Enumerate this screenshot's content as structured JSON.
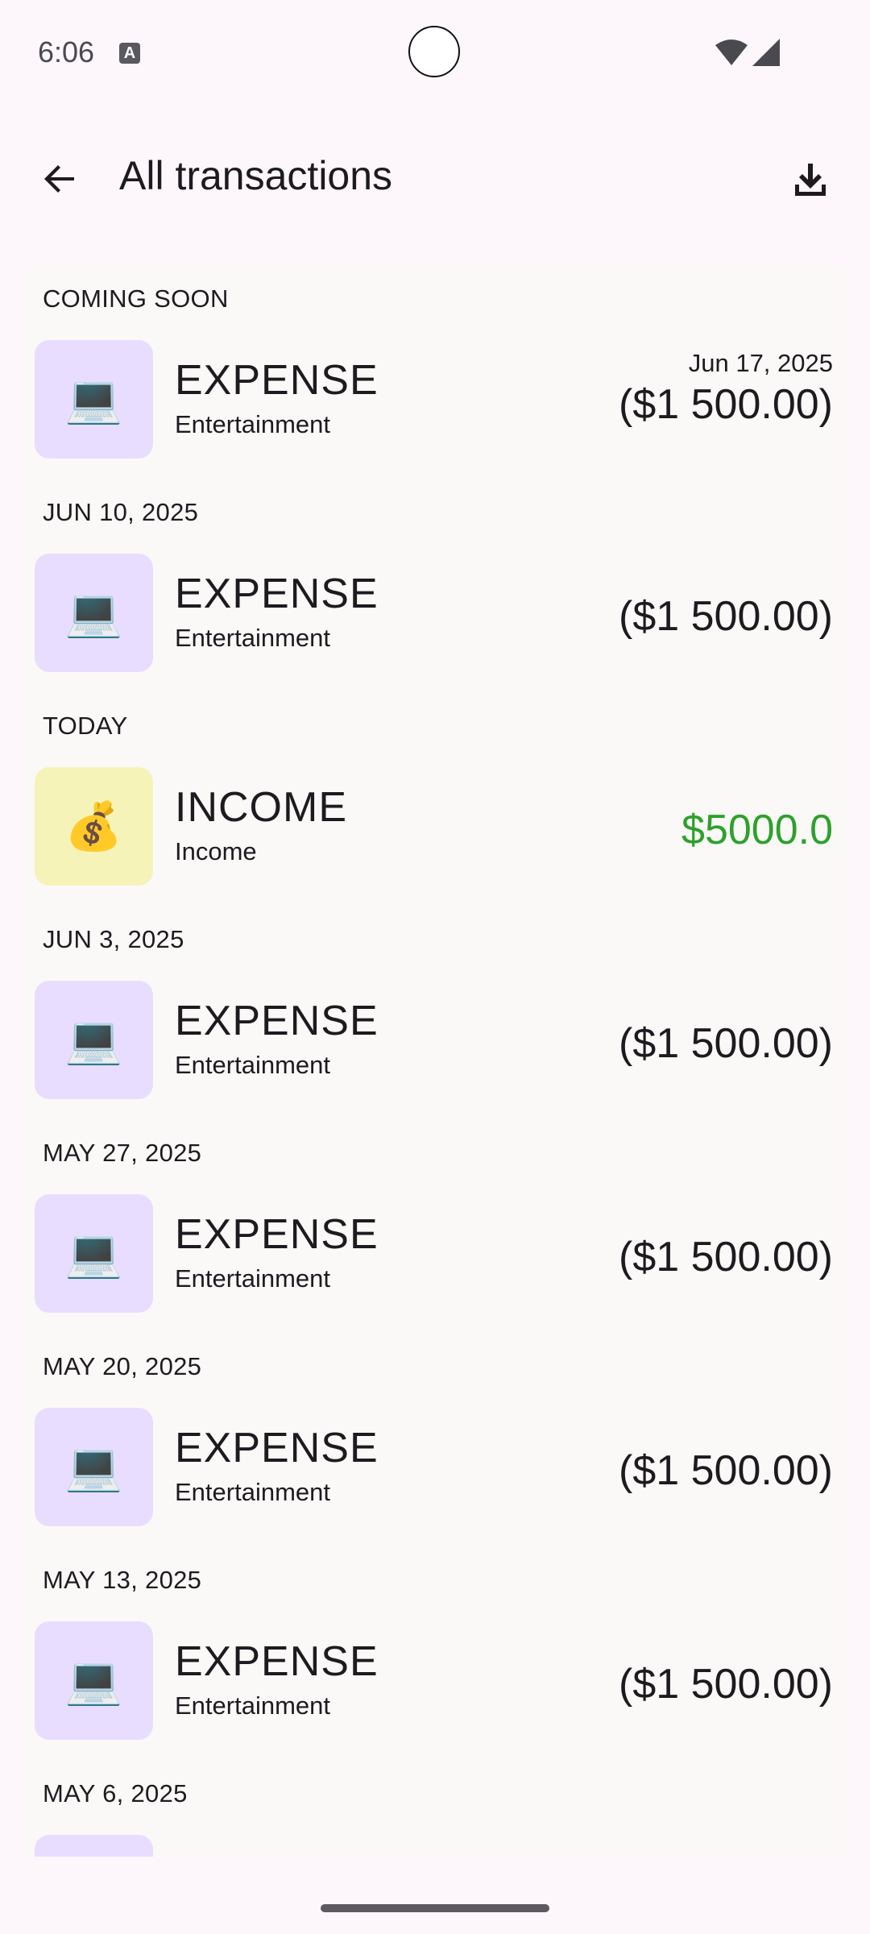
{
  "status_bar": {
    "time": "6:06",
    "a_icon_letter": "A"
  },
  "app_bar": {
    "title": "All transactions",
    "back_icon": "arrow-back-icon",
    "download_icon": "download-icon"
  },
  "sections": [
    {
      "header": "COMING SOON",
      "transaction": {
        "icon": "💻",
        "icon_name": "laptop-icon",
        "type": "EXPENSE",
        "category": "Entertainment",
        "date": "Jun 17, 2025",
        "amount": "($1 500.00)"
      }
    },
    {
      "header": "JUN 10, 2025",
      "transaction": {
        "icon": "💻",
        "icon_name": "laptop-icon",
        "type": "EXPENSE",
        "category": "Entertainment",
        "amount": "($1 500.00)"
      }
    },
    {
      "header": "TODAY",
      "transaction": {
        "icon": "💰",
        "icon_name": "money-bag-icon",
        "type": "INCOME",
        "category": "Income",
        "amount": "$5000.0"
      }
    },
    {
      "header": "JUN 3, 2025",
      "transaction": {
        "icon": "💻",
        "icon_name": "laptop-icon",
        "type": "EXPENSE",
        "category": "Entertainment",
        "amount": "($1 500.00)"
      }
    },
    {
      "header": "MAY 27, 2025",
      "transaction": {
        "icon": "💻",
        "icon_name": "laptop-icon",
        "type": "EXPENSE",
        "category": "Entertainment",
        "amount": "($1 500.00)"
      }
    },
    {
      "header": "MAY 20, 2025",
      "transaction": {
        "icon": "💻",
        "icon_name": "laptop-icon",
        "type": "EXPENSE",
        "category": "Entertainment",
        "amount": "($1 500.00)"
      }
    },
    {
      "header": "MAY 13, 2025",
      "transaction": {
        "icon": "💻",
        "icon_name": "laptop-icon",
        "type": "EXPENSE",
        "category": "Entertainment",
        "amount": "($1 500.00)"
      }
    },
    {
      "header": "MAY 6, 2025",
      "transaction": {
        "icon": "",
        "icon_name": "partial-item-icon",
        "type": "",
        "category": "",
        "amount": ""
      }
    }
  ],
  "colors": {
    "background": "#fdf7fc",
    "list_background": "#faf9f7",
    "expense_icon_bg": "#e9ddff",
    "income_icon_bg": "#f6f3b9",
    "income_amount": "#2ea12c"
  }
}
